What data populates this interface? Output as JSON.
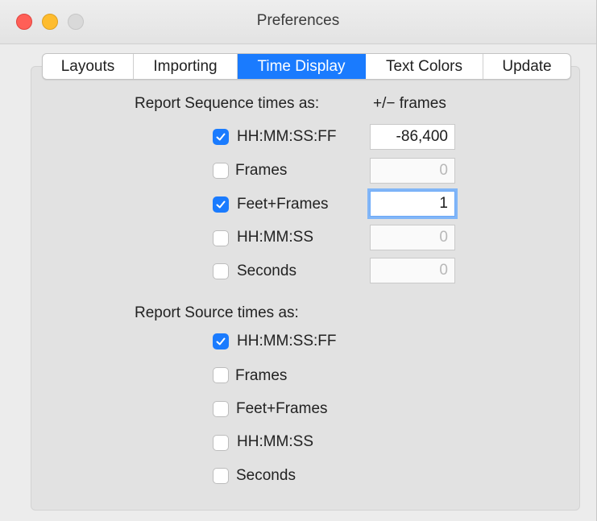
{
  "window": {
    "title": "Preferences"
  },
  "tabs": [
    {
      "label": "Layouts",
      "active": false
    },
    {
      "label": "Importing",
      "active": false
    },
    {
      "label": "Time Display",
      "active": true
    },
    {
      "label": "Text Colors",
      "active": false
    },
    {
      "label": "Update",
      "active": false
    }
  ],
  "sequence": {
    "heading": "Report Sequence times as:",
    "offset_heading": "+/− frames",
    "options": [
      {
        "label": "HH:MM:SS:FF",
        "checked": true,
        "value": "-86,400",
        "enabled": true
      },
      {
        "label": "Frames",
        "checked": false,
        "value": "0",
        "enabled": false
      },
      {
        "label": "Feet+Frames",
        "checked": true,
        "value": "1",
        "enabled": true,
        "focused": true
      },
      {
        "label": "HH:MM:SS",
        "checked": false,
        "value": "0",
        "enabled": false
      },
      {
        "label": "Seconds",
        "checked": false,
        "value": "0",
        "enabled": false
      }
    ]
  },
  "source": {
    "heading": "Report Source times as:",
    "options": [
      {
        "label": "HH:MM:SS:FF",
        "checked": true
      },
      {
        "label": "Frames",
        "checked": false
      },
      {
        "label": "Feet+Frames",
        "checked": false
      },
      {
        "label": "HH:MM:SS",
        "checked": false
      },
      {
        "label": "Seconds",
        "checked": false
      }
    ]
  },
  "colors": {
    "accent": "#1a7bfe",
    "focus_ring": "#82b6f7"
  },
  "icons": {
    "check": "checkmark-icon"
  }
}
